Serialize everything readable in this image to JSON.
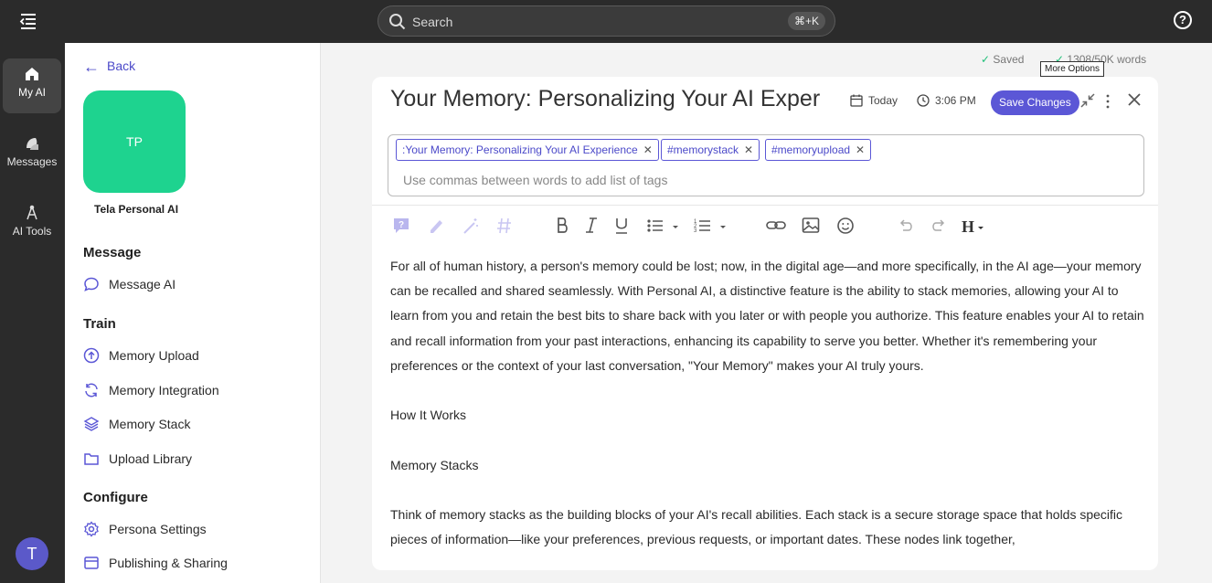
{
  "topbar": {
    "search_placeholder": "Search",
    "search_shortcut": "⌘+K"
  },
  "rail": {
    "items": [
      {
        "label": "My AI",
        "icon": "home-icon"
      },
      {
        "label": "Messages",
        "icon": "messages-icon"
      },
      {
        "label": "AI Tools",
        "icon": "ai-tools-icon"
      }
    ],
    "user_initial": "T"
  },
  "sidebar": {
    "back_label": "Back",
    "tile_initials": "TP",
    "tile_color": "#1ed38f",
    "persona_name": "Tela Personal AI",
    "sections": {
      "message": "Message",
      "train": "Train",
      "configure": "Configure"
    },
    "items": {
      "message_ai": "Message AI",
      "memory_upload": "Memory Upload",
      "memory_integration": "Memory Integration",
      "memory_stack": "Memory Stack",
      "upload_library": "Upload Library",
      "persona_settings": "Persona Settings",
      "publishing_sharing": "Publishing & Sharing"
    }
  },
  "editor": {
    "status_saved": "Saved",
    "word_count": "1308/50K words",
    "tooltip": "More Options",
    "title": "Your Memory: Personalizing Your AI Exper",
    "date": "Today",
    "time": "3:06 PM",
    "save_label": "Save Changes",
    "accent": "#5b57d6",
    "tags": [
      ":Your Memory: Personalizing Your AI Experience",
      "#memorystack",
      "#memoryupload"
    ],
    "tags_placeholder": "Use commas between words to add list of tags",
    "paragraphs": [
      "For all of human history, a person's memory could be lost; now, in the digital age—and more specifically, in the AI age—your memory can be recalled and shared seamlessly. With Personal AI, a distinctive feature is the ability to stack memories, allowing your AI to learn from you and retain the best bits to share back with you later or with people you authorize. This feature enables your AI to retain and recall information from your past interactions, enhancing its capability to serve you better. Whether it's remembering your preferences or the context of your last conversation, \"Your Memory\" makes your AI truly yours.",
      "How It Works",
      "Memory Stacks",
      "Think of memory stacks as the building blocks of your AI's recall abilities. Each stack is a secure storage space that holds specific pieces of information—like your preferences, previous requests, or important dates. These nodes link together,"
    ]
  }
}
